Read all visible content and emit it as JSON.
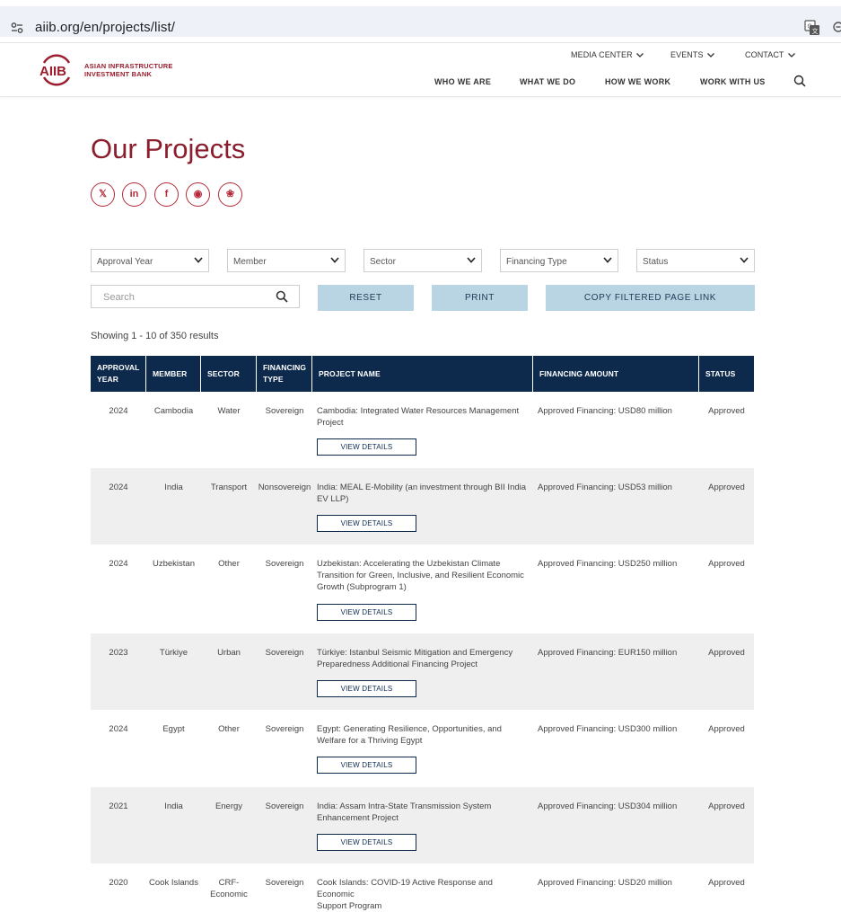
{
  "browser": {
    "url": "aiib.org/en/projects/list/"
  },
  "header": {
    "logo_mark": "AIIB",
    "logo_line1": "ASIAN INFRASTRUCTURE",
    "logo_line2": "INVESTMENT BANK",
    "top_nav": [
      "MEDIA CENTER",
      "EVENTS",
      "CONTACT"
    ],
    "main_nav": [
      "WHO WE ARE",
      "WHAT WE DO",
      "HOW WE WORK",
      "WORK WITH US"
    ]
  },
  "page": {
    "title": "Our Projects",
    "social": [
      {
        "icon": "x-icon",
        "glyph": "𝕏"
      },
      {
        "icon": "linkedin-icon",
        "glyph": "in"
      },
      {
        "icon": "facebook-icon",
        "glyph": "f"
      },
      {
        "icon": "weibo-icon",
        "glyph": "◉"
      },
      {
        "icon": "wechat-icon",
        "glyph": "❀"
      }
    ]
  },
  "filters": {
    "selects": [
      "Approval Year",
      "Member",
      "Sector",
      "Financing Type",
      "Status"
    ],
    "search_placeholder": "Search",
    "reset_label": "RESET",
    "print_label": "PRINT",
    "copy_label": "COPY FILTERED PAGE LINK"
  },
  "results": {
    "showing": "Showing 1 - 10 of 350 results"
  },
  "table": {
    "headers": [
      [
        "APPROVAL",
        "YEAR"
      ],
      [
        "MEMBER"
      ],
      [
        "SECTOR"
      ],
      [
        "FINANCING",
        "TYPE"
      ],
      [
        "PROJECT NAME"
      ],
      [
        "FINANCING AMOUNT"
      ],
      [
        "STATUS"
      ]
    ],
    "view_details_label": "VIEW DETAILS",
    "rows": [
      {
        "year": "2024",
        "member": "Cambodia",
        "sector": "Water",
        "type": "Sovereign",
        "name": [
          "Cambodia: Integrated Water Resources Management",
          "Project"
        ],
        "amount": "Approved Financing: USD80 million",
        "status": "Approved"
      },
      {
        "year": "2024",
        "member": "India",
        "sector": "Transport",
        "type": "Nonsovereign",
        "name": [
          "India: MEAL E-Mobility (an investment through BII India",
          "EV LLP)"
        ],
        "amount": "Approved Financing: USD53 million",
        "status": "Approved"
      },
      {
        "year": "2024",
        "member": "Uzbekistan",
        "sector": "Other",
        "type": "Sovereign",
        "name": [
          "Uzbekistan: Accelerating the Uzbekistan Climate",
          "Transition for Green, Inclusive, and Resilient Economic",
          "Growth (Subprogram 1)"
        ],
        "amount": "Approved Financing: USD250 million",
        "status": "Approved"
      },
      {
        "year": "2023",
        "member": "Türkiye",
        "sector": "Urban",
        "type": "Sovereign",
        "name": [
          "Türkiye: Istanbul Seismic Mitigation and Emergency",
          "Preparedness Additional Financing Project"
        ],
        "amount": "Approved Financing: EUR150 million",
        "status": "Approved"
      },
      {
        "year": "2024",
        "member": "Egypt",
        "sector": "Other",
        "type": "Sovereign",
        "name": [
          "Egypt: Generating Resilience, Opportunities, and",
          "Welfare for a Thriving Egypt"
        ],
        "amount": "Approved Financing: USD300 million",
        "status": "Approved"
      },
      {
        "year": "2021",
        "member": "India",
        "sector": "Energy",
        "type": "Sovereign",
        "name": [
          "India: Assam Intra-State Transmission System",
          "Enhancement Project"
        ],
        "amount": "Approved Financing: USD304 million",
        "status": "Approved"
      },
      {
        "year": "2020",
        "member": "Cook Islands",
        "sector": "CRF-Economic",
        "type": "Sovereign",
        "name": [
          "Cook Islands: COVID-19 Active Response and Economic",
          "Support Program"
        ],
        "amount": "Approved Financing: USD20 million",
        "status": "Approved"
      }
    ]
  }
}
